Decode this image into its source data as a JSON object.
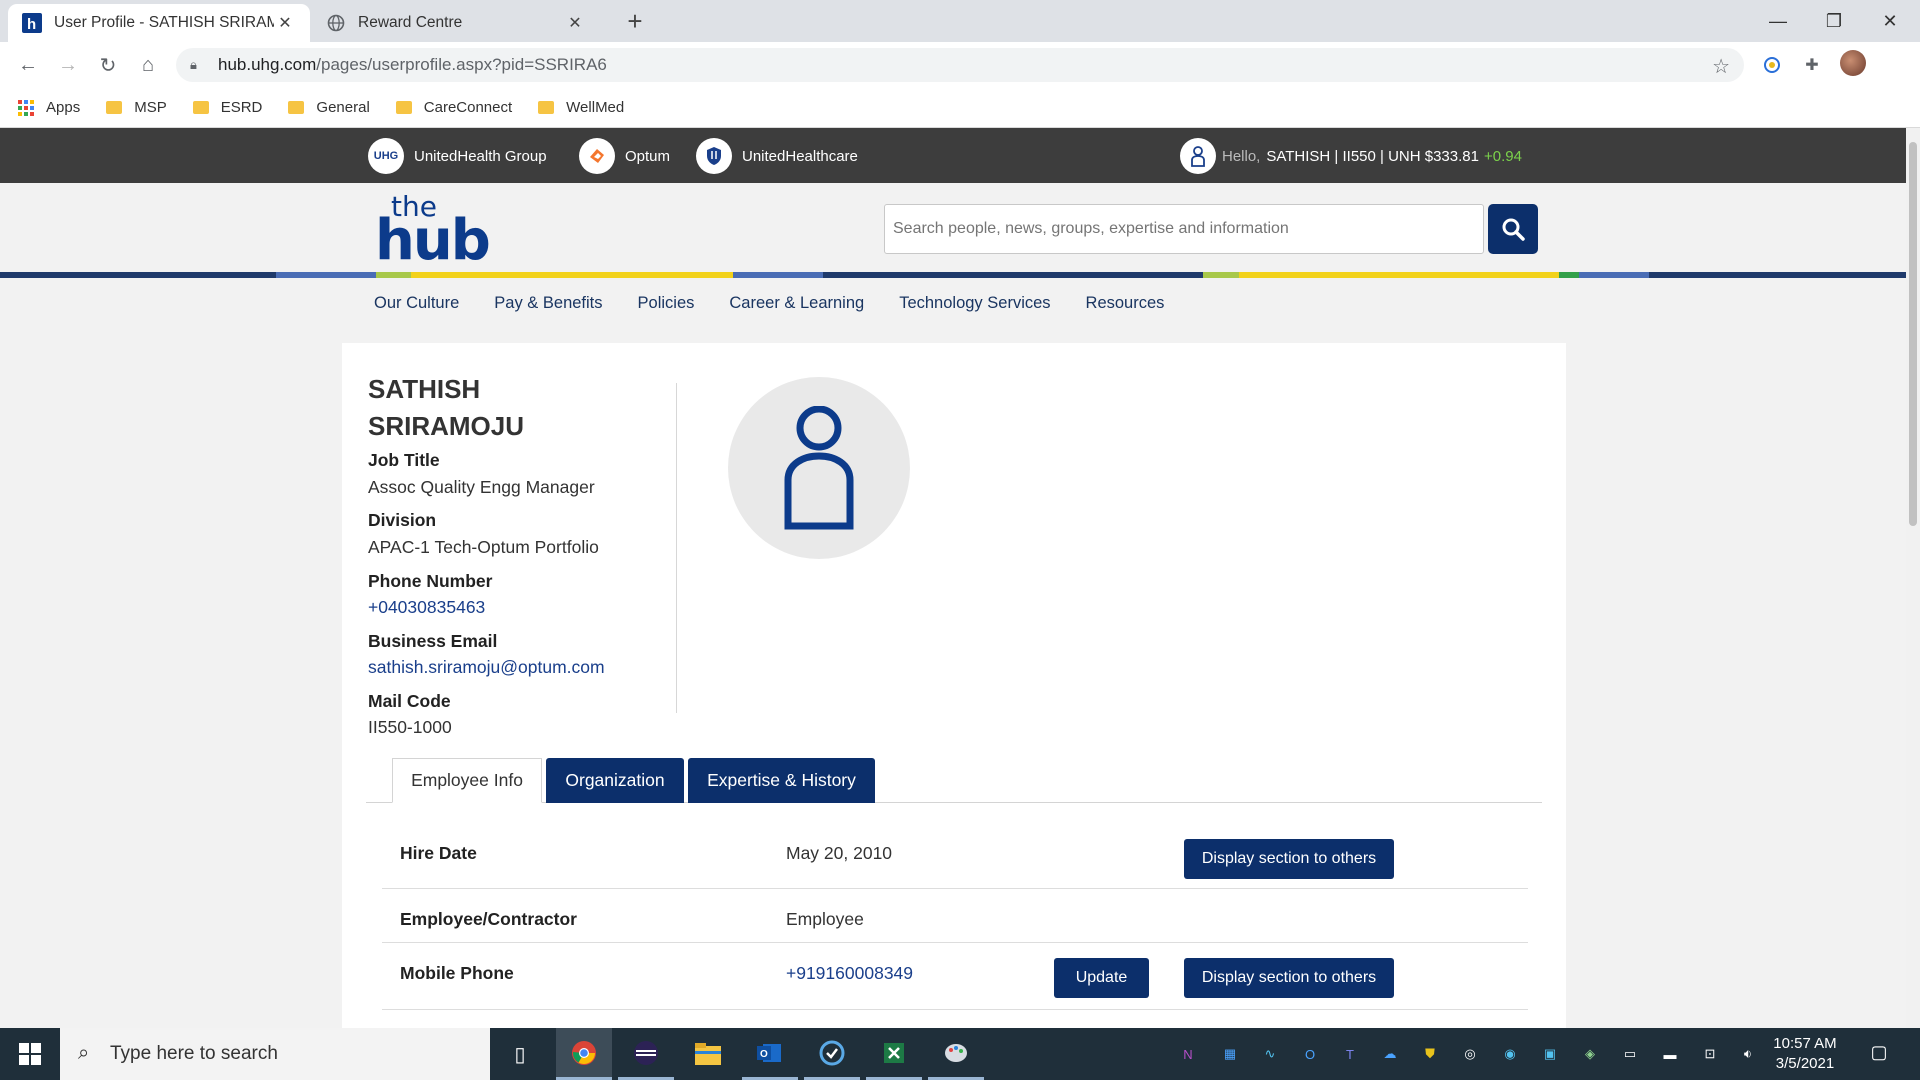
{
  "browser": {
    "tabs": [
      {
        "title": "User Profile - SATHISH SRIRAMO",
        "active": true
      },
      {
        "title": "Reward Centre",
        "active": false
      }
    ],
    "address": {
      "host": "hub.uhg.com",
      "path": "/pages/userprofile.aspx?pid=SSRIRA6"
    },
    "bookmarks": [
      "Apps",
      "MSP",
      "ESRD",
      "General",
      "CareConnect",
      "WellMed"
    ]
  },
  "topbar": {
    "brands": [
      "UnitedHealth Group",
      "Optum",
      "UnitedHealthcare"
    ],
    "uhg_badge": "UHG",
    "greeting": "Hello,",
    "user_info": "SATHISH | II550 | UNH $333.81",
    "stock_change": "+0.94"
  },
  "header": {
    "logo_the": "the",
    "logo_hub": "hub",
    "search_placeholder": "Search people, news, groups, expertise and information"
  },
  "nav": [
    "Our Culture",
    "Pay & Benefits",
    "Policies",
    "Career & Learning",
    "Technology Services",
    "Resources"
  ],
  "profile": {
    "name": "SATHISH SRIRAMOJU",
    "fields": [
      {
        "label": "Job Title",
        "value": "Assoc Quality Engg Manager"
      },
      {
        "label": "Division",
        "value": "APAC-1 Tech-Optum Portfolio"
      },
      {
        "label": "Phone Number",
        "value": "+04030835463"
      },
      {
        "label": "Business Email",
        "value": "sathish.sriramoju@optum.com"
      },
      {
        "label": "Mail Code",
        "value": "II550-1000"
      }
    ]
  },
  "profile_tabs": [
    "Employee Info",
    "Organization",
    "Expertise & History"
  ],
  "employee_info": [
    {
      "label": "Hire Date",
      "value": "May 20, 2010",
      "display_button": "Display section to others"
    },
    {
      "label": "Employee/Contractor",
      "value": "Employee"
    },
    {
      "label": "Mobile Phone",
      "value": "+919160008349",
      "update_button": "Update",
      "display_button": "Display section to others"
    }
  ],
  "taskbar": {
    "search_placeholder": "Type here to search",
    "time": "10:57 AM",
    "date": "3/5/2021"
  },
  "colors": {
    "brand_navy": "#0c2f6b",
    "topbar_bg": "#3d3d3d",
    "stock_green": "#7bd24b",
    "link_blue": "#1a3f8b"
  }
}
